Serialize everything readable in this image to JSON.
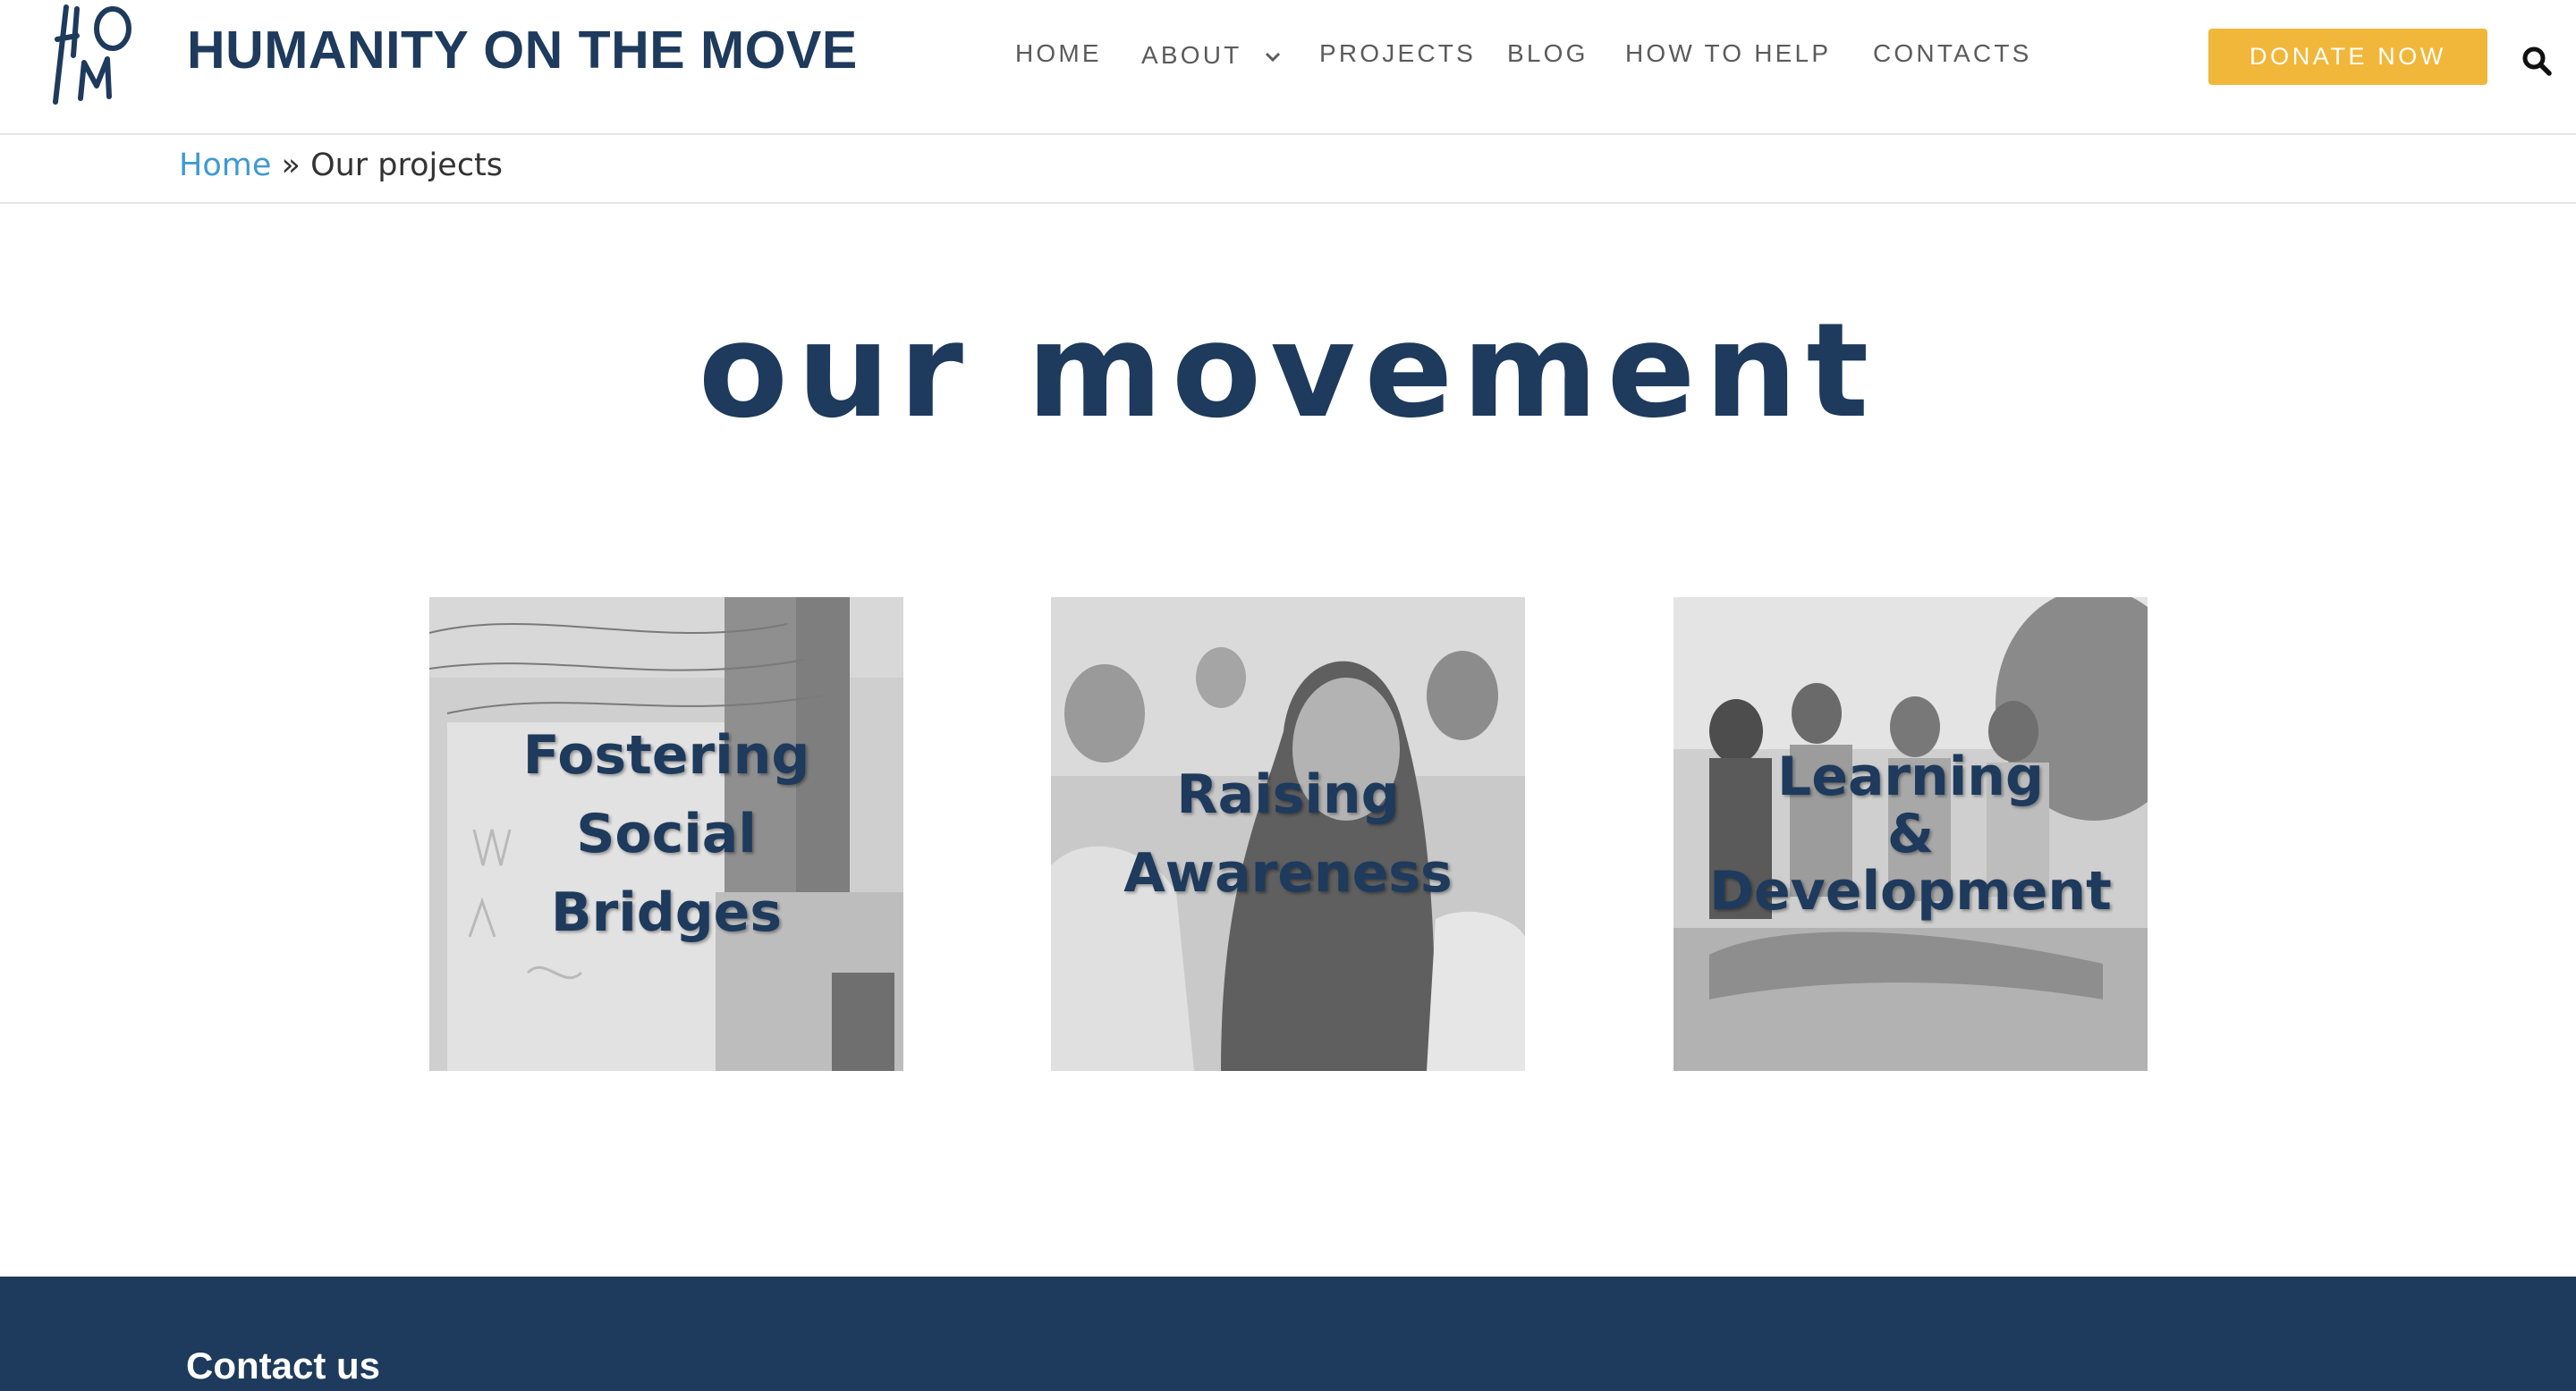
{
  "header": {
    "logo_letters": "HOM",
    "site_title": "HUMANITY ON THE MOVE",
    "nav": [
      {
        "label": "HOME"
      },
      {
        "label": "ABOUT"
      },
      {
        "label": "PROJECTS"
      },
      {
        "label": "BLOG"
      },
      {
        "label": "HOW TO HELP"
      },
      {
        "label": "CONTACTS"
      }
    ],
    "donate_label": "DONATE NOW",
    "search_icon": "search-icon"
  },
  "breadcrumb": {
    "home": "Home",
    "separator": "»",
    "current": "Our projects"
  },
  "main": {
    "heading": "our movement",
    "cards": [
      {
        "title": "Fostering\nSocial\nBridges"
      },
      {
        "title": "Raising\nAwareness"
      },
      {
        "title": "Learning\n&\nDevelopment"
      }
    ]
  },
  "footer": {
    "contact_heading": "Contact us"
  },
  "colors": {
    "brand_navy": "#1e3a5c",
    "donate_yellow": "#f0b73b",
    "link_blue": "#3f9ad0",
    "nav_grey": "#5b5b5b"
  }
}
